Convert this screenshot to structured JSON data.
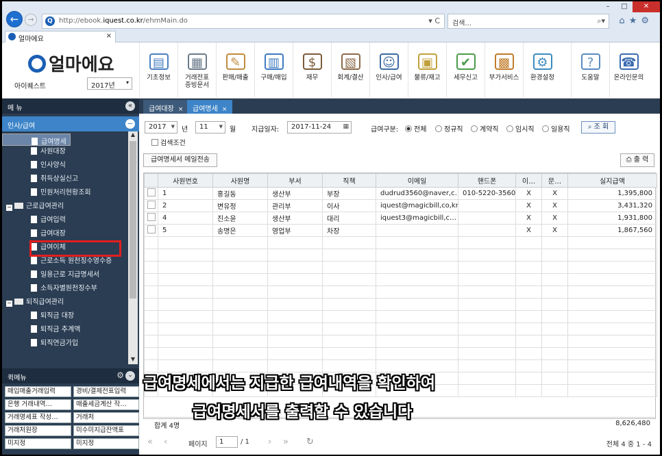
{
  "browser": {
    "url_prefix": "http://ebook.",
    "url_domain": "iquest.co.kr",
    "url_path": "/ehmMain.do",
    "search_placeholder": "검색...",
    "tab_title": "얼마에요",
    "tab_close": "×",
    "addr_controls": "▾ C",
    "search_icon": "search-icon"
  },
  "app": {
    "logo_text": "얼마에요",
    "company": "아이퀘스트",
    "year": "2017년",
    "toolbar": [
      {
        "label": "기초정보",
        "icon": "basic-info-icon",
        "color": "#4a7fc0"
      },
      {
        "label": "거래전표\n증빙문서",
        "icon": "voucher-icon",
        "color": "#6a7a8a"
      },
      {
        "label": "판매/매출",
        "icon": "sales-icon",
        "color": "#c08a3e"
      },
      {
        "label": "구매/매입",
        "icon": "purchase-icon",
        "color": "#3e7ac0"
      },
      {
        "label": "재무",
        "icon": "money-bag-icon",
        "color": "#7a5a3a"
      },
      {
        "label": "회계/결산",
        "icon": "accounting-icon",
        "color": "#8a6a4a"
      },
      {
        "label": "인사/급여",
        "icon": "hr-icon",
        "color": "#3a6aa0"
      },
      {
        "label": "물류/재고",
        "icon": "logistics-icon",
        "color": "#c0a03a"
      },
      {
        "label": "세무신고",
        "icon": "tax-icon",
        "color": "#4a9a4a"
      },
      {
        "label": "부가서비스",
        "icon": "bank-icon",
        "color": "#c07a2a"
      },
      {
        "label": "환경설정",
        "icon": "settings-gear-icon",
        "color": "#3a8ac0"
      },
      {
        "label": "도움말",
        "icon": "help-icon",
        "color": "#5a8ac0"
      },
      {
        "label": "온라인문의",
        "icon": "online-inquiry-icon",
        "color": "#3a6ab0"
      }
    ]
  },
  "sidebar": {
    "menu_title": "메 뉴",
    "collapse": "«",
    "section": "인사/급여",
    "section_toggle": "−",
    "tree": [
      {
        "label": "인사/4대보험",
        "level": 1
      },
      {
        "label": "사원대장",
        "level": 2
      },
      {
        "label": "인사양식",
        "level": 2
      },
      {
        "label": "취득상실신고",
        "level": 2
      },
      {
        "label": "민원처리현황조회",
        "level": 2
      },
      {
        "label": "근로급여관리",
        "level": 1
      },
      {
        "label": "급여입력",
        "level": 2
      },
      {
        "label": "급여대장",
        "level": 2
      },
      {
        "label": "급여명세",
        "level": 2,
        "selected": true
      },
      {
        "label": "급여이체",
        "level": 2
      },
      {
        "label": "근로소득 원천징수영수증",
        "level": 2
      },
      {
        "label": "일용근로 지급명세서",
        "level": 2
      },
      {
        "label": "소득자별원천징수부",
        "level": 2
      },
      {
        "label": "퇴직급여관리",
        "level": 1
      },
      {
        "label": "퇴직금 대장",
        "level": 2
      },
      {
        "label": "퇴직금 추계액",
        "level": 2
      },
      {
        "label": "퇴직연금가입",
        "level": 2
      }
    ],
    "quick_title": "퀵메뉴",
    "quick_gear": "⚙",
    "quick_toggle": "⌄",
    "quick": [
      "매입매출거래입력",
      "경비/결제전표입력",
      "은행 거래내역…",
      "매출세금계산 작…",
      "거래명세표 작성…",
      "거래처",
      "거래처원장",
      "미수미지급잔액표",
      "미지정",
      "미지정"
    ]
  },
  "main": {
    "tabs": [
      {
        "label": "급여대장",
        "close": "×"
      },
      {
        "label": "급여명세",
        "close": "×"
      }
    ],
    "filters": {
      "year": "2017",
      "year_unit": "년",
      "month": "11",
      "month_unit": "월",
      "pay_date_label": "지급일자:",
      "pay_date": "2017-11-24",
      "type_label": "급여구분:",
      "types": [
        {
          "label": "전체",
          "checked": true
        },
        {
          "label": "정규직",
          "checked": false
        },
        {
          "label": "계약직",
          "checked": false
        },
        {
          "label": "임시직",
          "checked": false
        },
        {
          "label": "일용직",
          "checked": false
        }
      ],
      "search_button": "조 회",
      "search_cond": "검색조건"
    },
    "mail_button": "급여명세서 메일전송",
    "print_button": "출 력",
    "columns": [
      "사원번호",
      "사원명",
      "부서",
      "직책",
      "이메일",
      "핸드폰",
      "이…",
      "문…",
      "실지급액"
    ],
    "rows": [
      {
        "no": "1",
        "name": "홍길동",
        "dept": "생산부",
        "title": "부장",
        "email": "dudrud3560@naver,c…",
        "phone": "010-5220-3560",
        "e": "X",
        "m": "X",
        "pay": "1,395,800"
      },
      {
        "no": "2",
        "name": "변유정",
        "dept": "관리부",
        "title": "이사",
        "email": "iquest@magicbill,co,kr",
        "phone": "",
        "e": "X",
        "m": "X",
        "pay": "3,431,320"
      },
      {
        "no": "4",
        "name": "진소윤",
        "dept": "생산부",
        "title": "대리",
        "email": "iquest3@magicbill,c…",
        "phone": "",
        "e": "X",
        "m": "X",
        "pay": "1,931,800"
      },
      {
        "no": "5",
        "name": "송명은",
        "dept": "영업부",
        "title": "차장",
        "email": "",
        "phone": "",
        "e": "X",
        "m": "X",
        "pay": "1,867,560"
      }
    ],
    "total_count": "합계  4명",
    "total_sum": "8,626,480",
    "pager": {
      "page_label": "페이지",
      "page": "1",
      "of": "/ 1",
      "summary": "전체 4 중 1 - 4"
    }
  },
  "subtitle": {
    "line1": "급여명세에서는 지급한 급여내역을 확인하여",
    "line2": "급여명세서를 출력할 수 있습니다"
  }
}
